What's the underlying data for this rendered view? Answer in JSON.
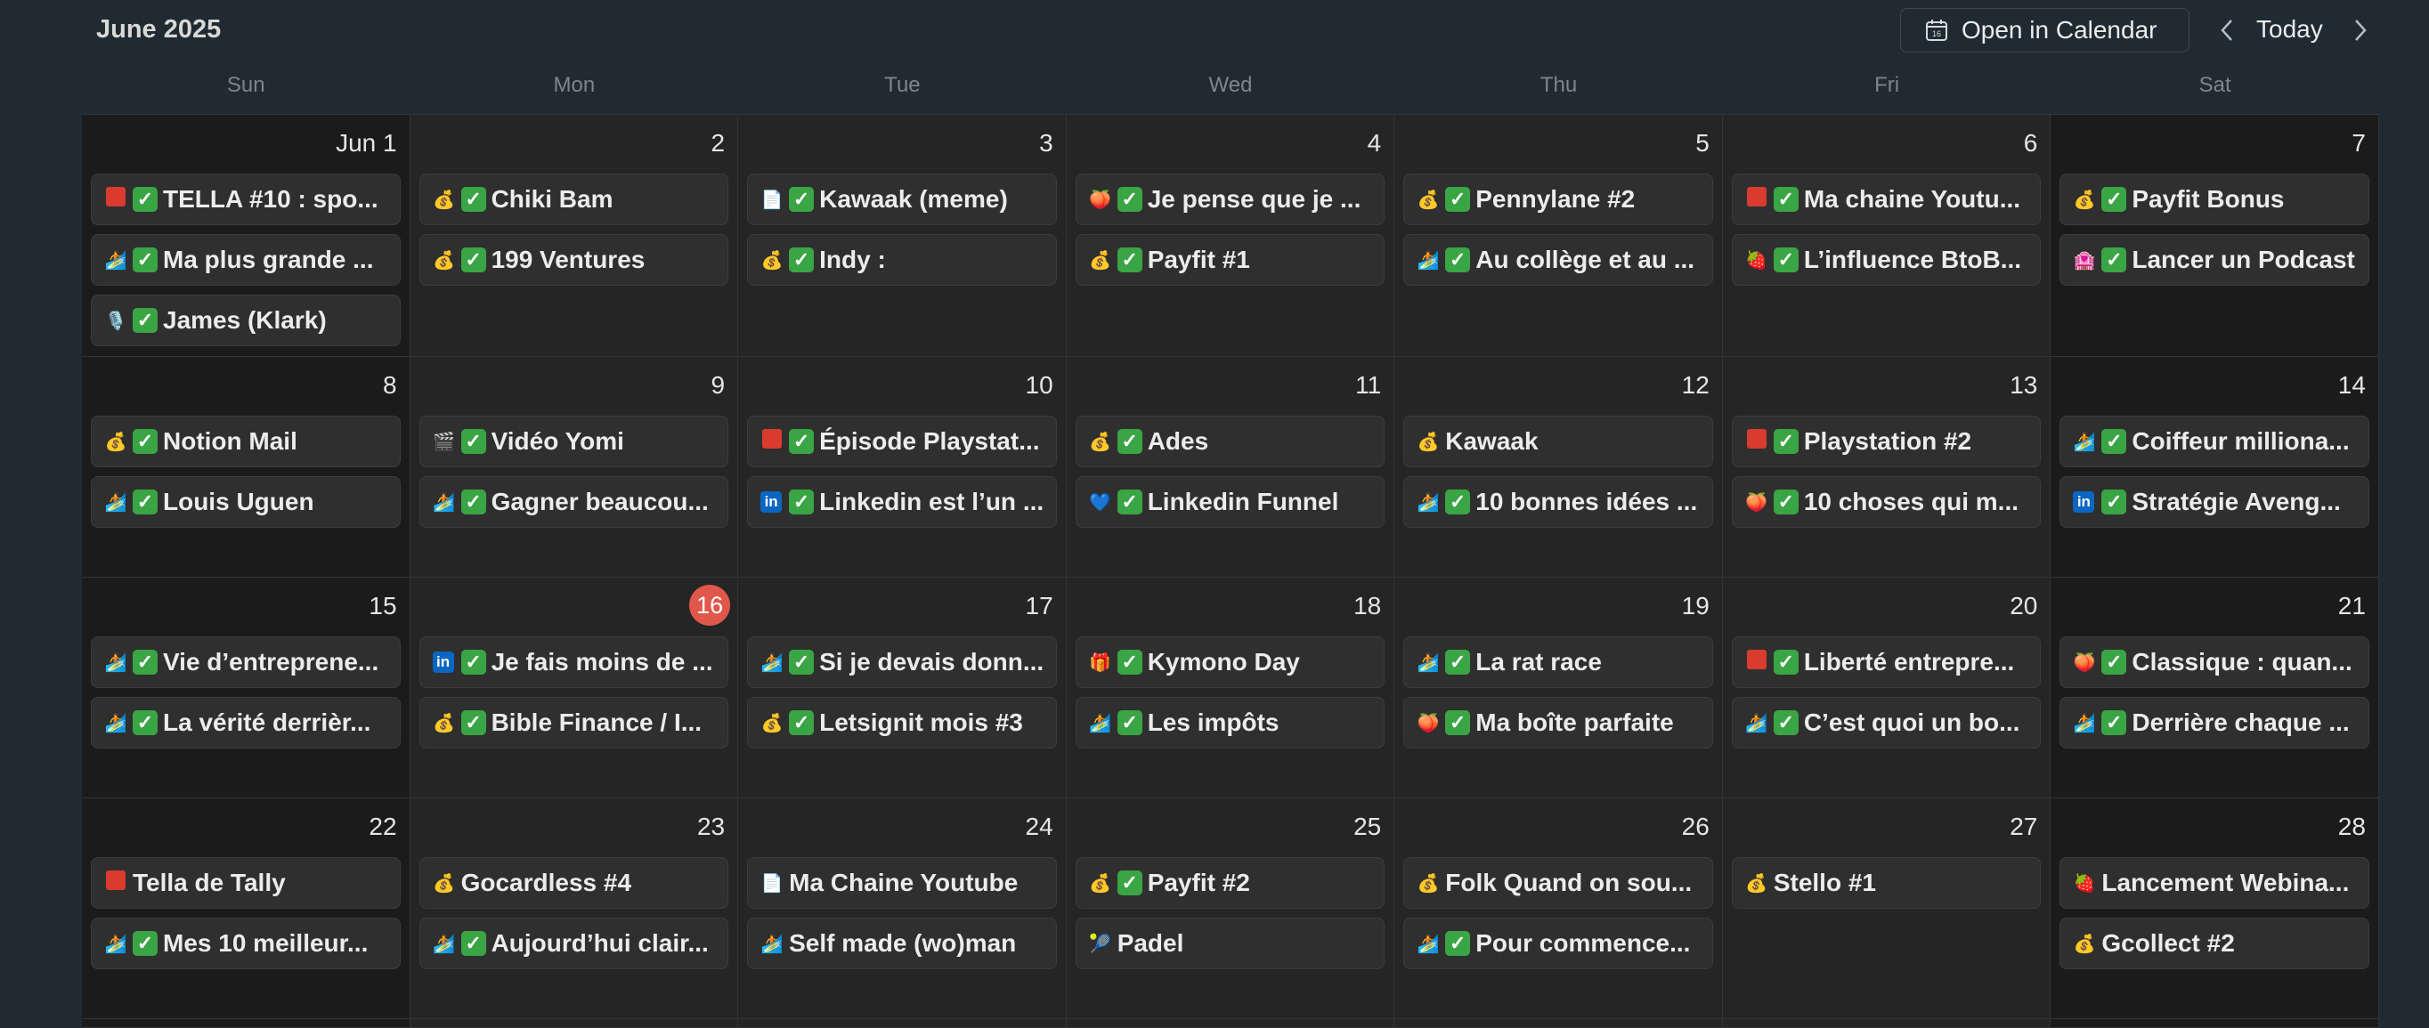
{
  "header": {
    "month": "June 2025",
    "open_label": "Open in Calendar",
    "today_label": "Today"
  },
  "weekdays": [
    "Sun",
    "Mon",
    "Tue",
    "Wed",
    "Thu",
    "Fri",
    "Sat"
  ],
  "today_day": "16",
  "weeks": [
    [
      {
        "day": "Jun 1",
        "events": [
          {
            "icon": "red-square",
            "done": true,
            "title": "TELLA #10 : spo..."
          },
          {
            "icon": "surfer",
            "done": true,
            "title": "Ma plus grande ..."
          },
          {
            "icon": "microphone",
            "done": true,
            "title": "James (Klark)"
          }
        ]
      },
      {
        "day": "2",
        "events": [
          {
            "icon": "money-bag",
            "done": true,
            "title": "Chiki Bam"
          },
          {
            "icon": "money-bag",
            "done": true,
            "title": "199 Ventures"
          }
        ]
      },
      {
        "day": "3",
        "events": [
          {
            "icon": "document",
            "done": true,
            "title": "Kawaak (meme)"
          },
          {
            "icon": "money-bag",
            "done": true,
            "title": "Indy :"
          }
        ]
      },
      {
        "day": "4",
        "events": [
          {
            "icon": "peach",
            "done": true,
            "title": "Je pense que je ..."
          },
          {
            "icon": "money-bag",
            "done": true,
            "title": "Payfit #1"
          }
        ]
      },
      {
        "day": "5",
        "events": [
          {
            "icon": "money-bag",
            "done": true,
            "title": "Pennylane #2"
          },
          {
            "icon": "surfer",
            "done": true,
            "title": "Au collège et au ..."
          }
        ]
      },
      {
        "day": "6",
        "events": [
          {
            "icon": "red-square",
            "done": true,
            "title": "Ma chaine Youtu..."
          },
          {
            "icon": "strawberry",
            "done": true,
            "title": "L’influence BtoB..."
          }
        ]
      },
      {
        "day": "7",
        "events": [
          {
            "icon": "money-bag",
            "done": true,
            "title": "Payfit Bonus"
          },
          {
            "icon": "building",
            "done": true,
            "title": "Lancer un Podcast"
          }
        ]
      }
    ],
    [
      {
        "day": "8",
        "events": [
          {
            "icon": "money-bag",
            "done": true,
            "title": "Notion Mail"
          },
          {
            "icon": "surfer",
            "done": true,
            "title": "Louis Uguen"
          }
        ]
      },
      {
        "day": "9",
        "events": [
          {
            "icon": "clapper",
            "done": true,
            "title": "Vidéo Yomi"
          },
          {
            "icon": "surfer",
            "done": true,
            "title": "Gagner beaucou..."
          }
        ]
      },
      {
        "day": "10",
        "events": [
          {
            "icon": "red-square",
            "done": true,
            "title": "Épisode Playstat..."
          },
          {
            "icon": "linkedin",
            "done": true,
            "title": "Linkedin est l’un ..."
          }
        ]
      },
      {
        "day": "11",
        "events": [
          {
            "icon": "money-bag",
            "done": true,
            "title": "Ades"
          },
          {
            "icon": "blue-heart",
            "done": true,
            "title": "Linkedin Funnel"
          }
        ]
      },
      {
        "day": "12",
        "events": [
          {
            "icon": "money-bag",
            "done": false,
            "title": "Kawaak"
          },
          {
            "icon": "surfer",
            "done": true,
            "title": "10 bonnes idées ..."
          }
        ]
      },
      {
        "day": "13",
        "events": [
          {
            "icon": "red-square",
            "done": true,
            "title": "Playstation #2"
          },
          {
            "icon": "peach",
            "done": true,
            "title": "10 choses qui m..."
          }
        ]
      },
      {
        "day": "14",
        "events": [
          {
            "icon": "surfer",
            "done": true,
            "title": "Coiffeur milliona..."
          },
          {
            "icon": "linkedin",
            "done": true,
            "title": "Stratégie Aveng..."
          }
        ]
      }
    ],
    [
      {
        "day": "15",
        "events": [
          {
            "icon": "surfer",
            "done": true,
            "title": "Vie d’entreprene..."
          },
          {
            "icon": "surfer",
            "done": true,
            "title": "La vérité derrièr..."
          }
        ]
      },
      {
        "day": "16",
        "events": [
          {
            "icon": "linkedin",
            "done": true,
            "title": "Je fais moins de ..."
          },
          {
            "icon": "money-bag",
            "done": true,
            "title": "Bible Finance / I..."
          }
        ]
      },
      {
        "day": "17",
        "events": [
          {
            "icon": "surfer",
            "done": true,
            "title": "Si je devais donn..."
          },
          {
            "icon": "money-bag",
            "done": true,
            "title": "Letsignit mois #3"
          }
        ]
      },
      {
        "day": "18",
        "events": [
          {
            "icon": "gift",
            "done": true,
            "title": "Kymono Day"
          },
          {
            "icon": "surfer",
            "done": true,
            "title": "Les impôts"
          }
        ]
      },
      {
        "day": "19",
        "events": [
          {
            "icon": "surfer",
            "done": true,
            "title": "La rat race"
          },
          {
            "icon": "peach",
            "done": true,
            "title": "Ma boîte parfaite"
          }
        ]
      },
      {
        "day": "20",
        "events": [
          {
            "icon": "red-square",
            "done": true,
            "title": "Liberté entrepre..."
          },
          {
            "icon": "surfer",
            "done": true,
            "title": "C’est quoi un bo..."
          }
        ]
      },
      {
        "day": "21",
        "events": [
          {
            "icon": "peach",
            "done": true,
            "title": "Classique : quan..."
          },
          {
            "icon": "surfer",
            "done": true,
            "title": "Derrière chaque ..."
          }
        ]
      }
    ],
    [
      {
        "day": "22",
        "events": [
          {
            "icon": "red-square",
            "done": false,
            "title": "Tella de Tally"
          },
          {
            "icon": "surfer",
            "done": true,
            "title": "Mes 10 meilleur..."
          }
        ]
      },
      {
        "day": "23",
        "events": [
          {
            "icon": "money-bag",
            "done": false,
            "title": "Gocardless #4"
          },
          {
            "icon": "surfer",
            "done": true,
            "title": "Aujourd’hui clair..."
          }
        ]
      },
      {
        "day": "24",
        "events": [
          {
            "icon": "document",
            "done": false,
            "title": "Ma Chaine Youtube"
          },
          {
            "icon": "surfer",
            "done": false,
            "title": "Self made (wo)man"
          }
        ]
      },
      {
        "day": "25",
        "events": [
          {
            "icon": "money-bag",
            "done": true,
            "title": "Payfit #2"
          },
          {
            "icon": "tennis-ball",
            "done": false,
            "title": "Padel"
          }
        ]
      },
      {
        "day": "26",
        "events": [
          {
            "icon": "money-bag",
            "done": false,
            "title": "Folk Quand on sou..."
          },
          {
            "icon": "surfer",
            "done": true,
            "title": "Pour commence..."
          }
        ]
      },
      {
        "day": "27",
        "events": [
          {
            "icon": "money-bag",
            "done": false,
            "title": "Stello #1"
          }
        ]
      },
      {
        "day": "28",
        "events": [
          {
            "icon": "strawberry",
            "done": false,
            "title": "Lancement Webina..."
          },
          {
            "icon": "money-bag",
            "done": false,
            "title": "Gcollect #2"
          }
        ]
      }
    ]
  ]
}
